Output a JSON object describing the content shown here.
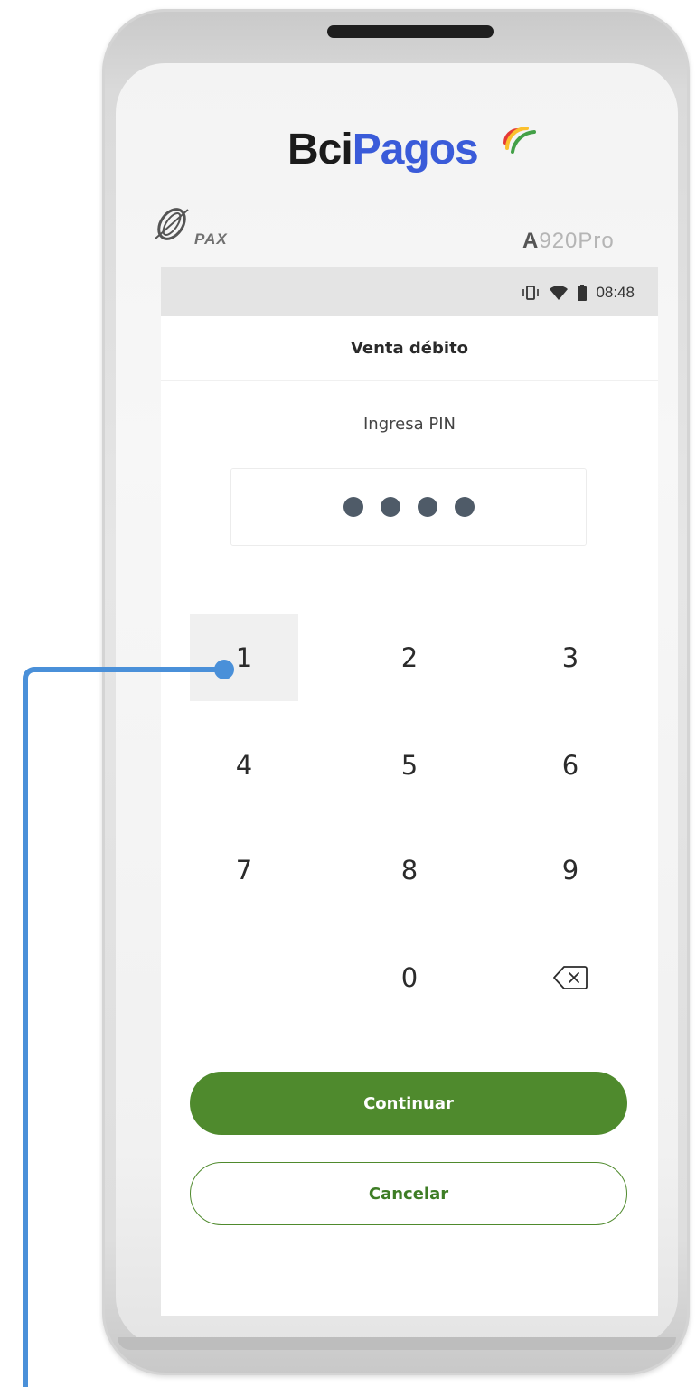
{
  "device": {
    "brand_part1": "Bci",
    "brand_part2": "Pagos",
    "maker": "PAX",
    "model_first": "A",
    "model_rest": "920Pro"
  },
  "status_bar": {
    "time": "08:48",
    "icons": [
      "vibrate-icon",
      "wifi-icon",
      "battery-icon"
    ]
  },
  "screen": {
    "title": "Venta débito",
    "pin_prompt": "Ingresa PIN",
    "pin_digits_entered": 4
  },
  "keypad": {
    "keys": [
      "1",
      "2",
      "3",
      "4",
      "5",
      "6",
      "7",
      "8",
      "9",
      "0"
    ],
    "pressed_key": "1",
    "delete_icon": "backspace-icon"
  },
  "actions": {
    "continue_label": "Continuar",
    "cancel_label": "Cancelar"
  },
  "colors": {
    "primary_green": "#4f8a2d",
    "brand_blue": "#3a5bd9",
    "callout_blue": "#4a90d9",
    "pin_dot": "#4f5b68"
  }
}
